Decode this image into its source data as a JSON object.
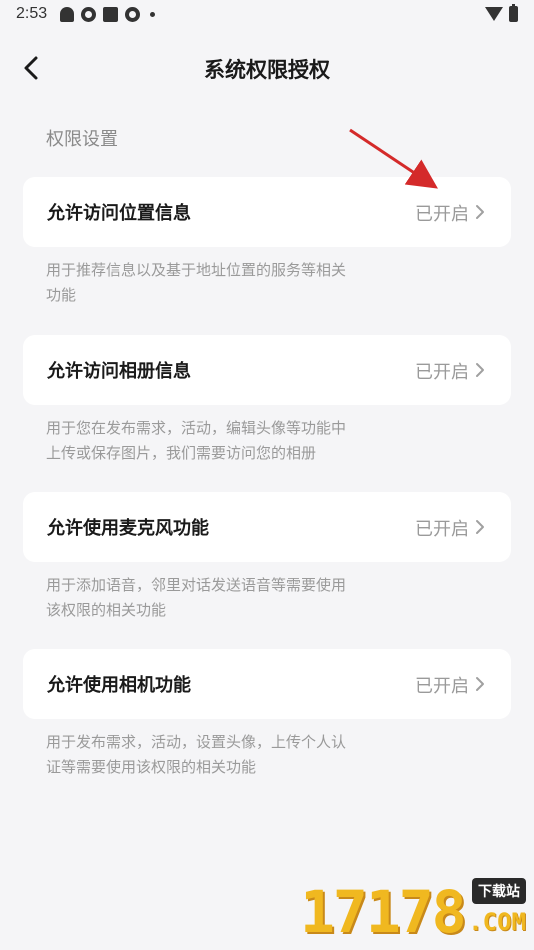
{
  "status_bar": {
    "time": "2:53"
  },
  "header": {
    "title": "系统权限授权"
  },
  "section": {
    "title": "权限设置"
  },
  "permissions": [
    {
      "label": "允许访问位置信息",
      "status": "已开启",
      "desc_lines": [
        "用于推荐信息以及基于地址位置的服务等相关",
        "功能"
      ]
    },
    {
      "label": "允许访问相册信息",
      "status": "已开启",
      "desc_lines": [
        "用于您在发布需求，活动，编辑头像等功能中",
        "上传或保存图片，我们需要访问您的相册"
      ]
    },
    {
      "label": "允许使用麦克风功能",
      "status": "已开启",
      "desc_lines": [
        "用于添加语音，邻里对话发送语音等需要使用",
        "该权限的相关功能"
      ]
    },
    {
      "label": "允许使用相机功能",
      "status": "已开启",
      "desc_lines": [
        "用于发布需求，活动，设置头像，上传个人认",
        "证等需要使用该权限的相关功能"
      ]
    }
  ],
  "watermark": {
    "digits": "17178",
    "tag": "下载站",
    "suffix": ".COM"
  },
  "colors": {
    "background": "#f5f5f7",
    "card": "#ffffff",
    "muted_text": "#9a9a9a",
    "arrow": "#d42a2a"
  }
}
